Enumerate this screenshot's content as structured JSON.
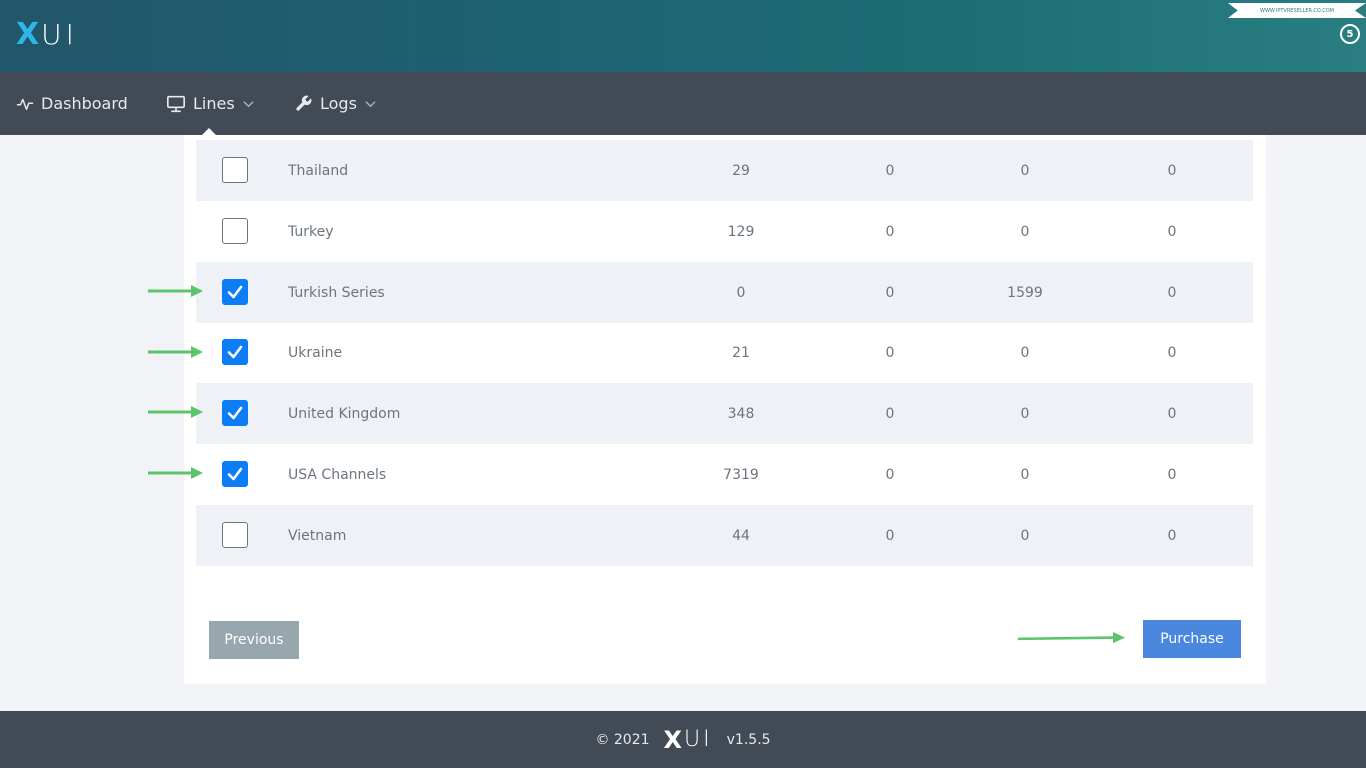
{
  "header": {
    "logo_x": "X",
    "logo_ui": "UI",
    "ribbon_text": "WWW.IPTVRESELLER.CO.COM",
    "badge_text": "5"
  },
  "nav": {
    "items": [
      {
        "label": "Dashboard",
        "icon": "activity-icon",
        "has_dropdown": false
      },
      {
        "label": "Lines",
        "icon": "monitor-icon",
        "has_dropdown": true
      },
      {
        "label": "Logs",
        "icon": "wrench-icon",
        "has_dropdown": true
      }
    ]
  },
  "table": {
    "rows": [
      {
        "name": "Thailand",
        "checked": false,
        "c1": "29",
        "c2": "0",
        "c3": "0",
        "c4": "0"
      },
      {
        "name": "Turkey",
        "checked": false,
        "c1": "129",
        "c2": "0",
        "c3": "0",
        "c4": "0"
      },
      {
        "name": "Turkish Series",
        "checked": true,
        "c1": "0",
        "c2": "0",
        "c3": "1599",
        "c4": "0"
      },
      {
        "name": "Ukraine",
        "checked": true,
        "c1": "21",
        "c2": "0",
        "c3": "0",
        "c4": "0"
      },
      {
        "name": "United Kingdom",
        "checked": true,
        "c1": "348",
        "c2": "0",
        "c3": "0",
        "c4": "0"
      },
      {
        "name": "USA Channels",
        "checked": true,
        "c1": "7319",
        "c2": "0",
        "c3": "0",
        "c4": "0"
      },
      {
        "name": "Vietnam",
        "checked": false,
        "c1": "44",
        "c2": "0",
        "c3": "0",
        "c4": "0"
      }
    ]
  },
  "buttons": {
    "previous": "Previous",
    "purchase": "Purchase"
  },
  "footer": {
    "copyright": "© 2021",
    "logo_x": "X",
    "logo_ui": "UI",
    "version": "v1.5.5"
  },
  "colors": {
    "accent": "#0d7df5",
    "arrow": "#5cc46a",
    "purchase_button": "#4a88e0",
    "previous_button": "#98a6ad"
  }
}
